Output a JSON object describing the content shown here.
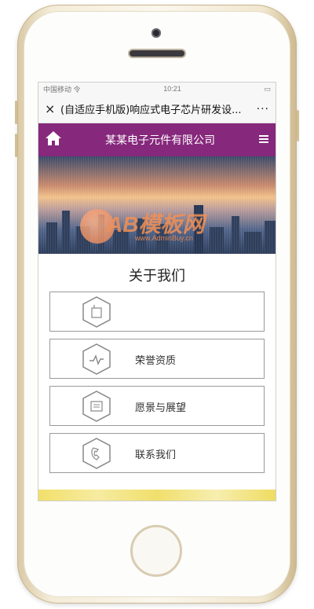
{
  "status_bar": {
    "carrier": "中国移动 令",
    "time": "10:21",
    "battery": "▭"
  },
  "nav_bar": {
    "close_glyph": "×",
    "title": "(自适应手机版)响应式电子芯片研发设...",
    "more_glyph": "···"
  },
  "header": {
    "home_icon": "home-icon",
    "title": "某某电子元件有限公司",
    "menu_icon": "menu-icon"
  },
  "section": {
    "title": "关于我们"
  },
  "items": [
    {
      "label": "",
      "icon": "company-icon"
    },
    {
      "label": "荣誉资质",
      "icon": "pulse-icon"
    },
    {
      "label": "愿景与展望",
      "icon": "document-icon"
    },
    {
      "label": "联系我们",
      "icon": "phone-icon"
    }
  ],
  "watermark": {
    "main": "AB模板网",
    "sub": "www.AdminBuy.cn"
  },
  "colors": {
    "brand": "#86287c",
    "border": "#9a9a9a",
    "accent_strip": "#f2e06a"
  }
}
